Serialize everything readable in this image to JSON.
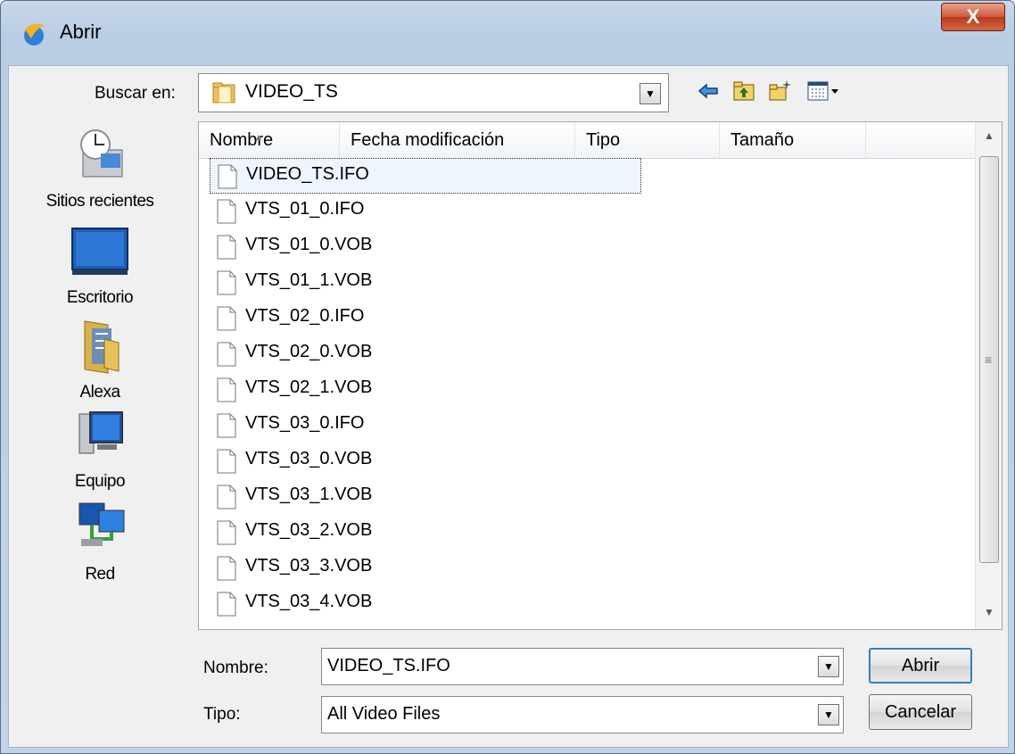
{
  "window": {
    "title": "Abrir",
    "close_label": "X"
  },
  "lookin": {
    "label": "Buscar en:",
    "value": "VIDEO_TS"
  },
  "places": [
    {
      "label": "Sitios recientes",
      "icon": "recent-places-icon"
    },
    {
      "label": "Escritorio",
      "icon": "desktop-icon"
    },
    {
      "label": "Alexa",
      "icon": "user-folder-icon"
    },
    {
      "label": "Equipo",
      "icon": "computer-icon"
    },
    {
      "label": "Red",
      "icon": "network-icon"
    }
  ],
  "columns": {
    "name": "Nombre",
    "date": "Fecha modificación",
    "type": "Tipo",
    "size": "Tamaño"
  },
  "files": [
    "VIDEO_TS.IFO",
    "VTS_01_0.IFO",
    "VTS_01_0.VOB",
    "VTS_01_1.VOB",
    "VTS_02_0.IFO",
    "VTS_02_0.VOB",
    "VTS_02_1.VOB",
    "VTS_03_0.IFO",
    "VTS_03_0.VOB",
    "VTS_03_1.VOB",
    "VTS_03_2.VOB",
    "VTS_03_3.VOB",
    "VTS_03_4.VOB"
  ],
  "filename": {
    "label": "Nombre:",
    "value": "VIDEO_TS.IFO"
  },
  "filetype": {
    "label": "Tipo:",
    "value": "All Video Files"
  },
  "buttons": {
    "open": "Abrir",
    "cancel": "Cancelar"
  }
}
